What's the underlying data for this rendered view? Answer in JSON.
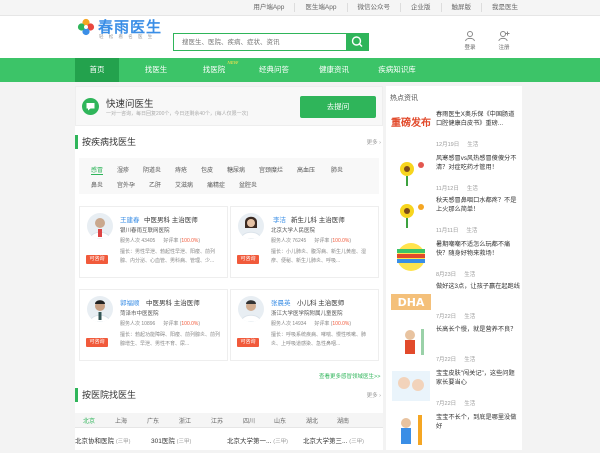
{
  "topbar": {
    "links": [
      "用户端App",
      "医生端App",
      "微信公众号",
      "企业版",
      "触屏版",
      "我是医生"
    ]
  },
  "header": {
    "logo_name": "春雨医生",
    "logo_sub": "轻 松 看 名 医 生",
    "search_placeholder": "搜医生、医院、疾病、症状、资讯",
    "login_label": "登录",
    "register_label": "注册"
  },
  "nav": {
    "items": [
      "首页",
      "找医生",
      "找医院",
      "经典问答",
      "健康资讯",
      "疾病知识库"
    ],
    "new_badge": "NEW",
    "active": "首页"
  },
  "quick": {
    "title": "快速问医生",
    "subtitle": "一对一咨询，每日回复200个，今日还剩余40个，(每人仅限一次)",
    "ask_label": "去提问"
  },
  "disease_section": {
    "title": "按疾病找医生",
    "more": "更多",
    "tags_row1": [
      "感冒",
      "湿疹",
      "阴道炎",
      "痔疮",
      "包皮",
      "糖尿病",
      "宫颈糜烂",
      "高血压",
      "肺炎"
    ],
    "tags_row2": [
      "鼻炎",
      "宫外孕",
      "乙肝",
      "艾滋病",
      "痛精症",
      "盆腔炎"
    ],
    "active_tag": "感冒"
  },
  "doctors": [
    {
      "name": "王建春",
      "role": "中医男科  主治医师",
      "hospital": "银川春雨互联网医院",
      "serves": "43405",
      "rate": "100.0%",
      "skill": "擅长：男性早泄、勃起性早泄、阳痿、前列腺、内分泌、心血管、男科病、管理、少...",
      "badge": "可咨询"
    },
    {
      "name": "李洁",
      "role": "新生儿科  主治医师",
      "hospital": "北京大学人民医院",
      "serves": "76245",
      "rate": "100.0%",
      "skill": "擅长：小儿肺炎、腹泻病、新生儿黄疸、湿疹、便秘、新生儿肺炎、呼吸...",
      "badge": "可咨询"
    },
    {
      "name": "郭福顺",
      "role": "中医男科  主治医师",
      "hospital": "菏泽市中医医院",
      "serves": "10896",
      "rate": "100.0%",
      "skill": "擅长：勃起功能障碍、阳痿、前列腺炎、前列腺增生、早泄、男性不育、尿...",
      "badge": "可咨询"
    },
    {
      "name": "张晨英",
      "role": "小儿科  主治医师",
      "hospital": "浙江大学医学院附属儿童医院",
      "serves": "14934",
      "rate": "100.0%",
      "skill": "擅长：呼吸系统疾病、哮喘、慢性咳嗽、肺炎、上呼吸道感染、急性鼻咽...",
      "badge": "可咨询"
    }
  ],
  "doctor_labels": {
    "serves_prefix": "服务人次",
    "rate_prefix": "好评率"
  },
  "more_doctors_link": "查看更多感冒领域医生>>",
  "hospital_section": {
    "title": "按医院找医生",
    "more": "更多",
    "cities": [
      "北京",
      "上海",
      "广东",
      "浙江",
      "江苏",
      "四川",
      "山东",
      "湖北",
      "湖南"
    ],
    "active_city": "北京",
    "hospitals": [
      {
        "name": "北京协和医院",
        "level": "(三甲)"
      },
      {
        "name": "301医院",
        "level": "(三甲)"
      },
      {
        "name": "北京大学第一...",
        "level": "(三甲)"
      },
      {
        "name": "北京大学第三...",
        "level": "(三甲)"
      }
    ]
  },
  "sidebar": {
    "title": "热点资讯",
    "news": [
      {
        "title": "春雨医生X奥乐保《中国肠道口腔健康白皮书》重磅...",
        "date": "12月19日",
        "cat": "生活",
        "thumb": "重磅发布"
      },
      {
        "title": "风寒感冒vs风热感冒傻傻分不清？对症吃药才管用！",
        "date": "11月12日",
        "cat": "生活"
      },
      {
        "title": "秋天感冒鼻咽口水都疼？不是上火那么简单！",
        "date": "11月11日",
        "cat": "生活"
      },
      {
        "title": "暑期嘲嘲不适怎么玩都不痛快？随身好物来救场！",
        "date": "8月23日",
        "cat": "生活"
      },
      {
        "title": "做好这3点，让孩子赢在起跑线",
        "date": "7月22日",
        "cat": "生活",
        "thumb": "DHA"
      },
      {
        "title": "长高长个慢，就是营养不良？",
        "date": "7月22日",
        "cat": "生活"
      },
      {
        "title": "宝宝皮肤\"闯关记\"，这些问题家长要当心",
        "date": "7月22日",
        "cat": "生活"
      },
      {
        "title": "宝宝不长个，到底是哪里没做好",
        "date": "",
        "cat": ""
      }
    ]
  }
}
